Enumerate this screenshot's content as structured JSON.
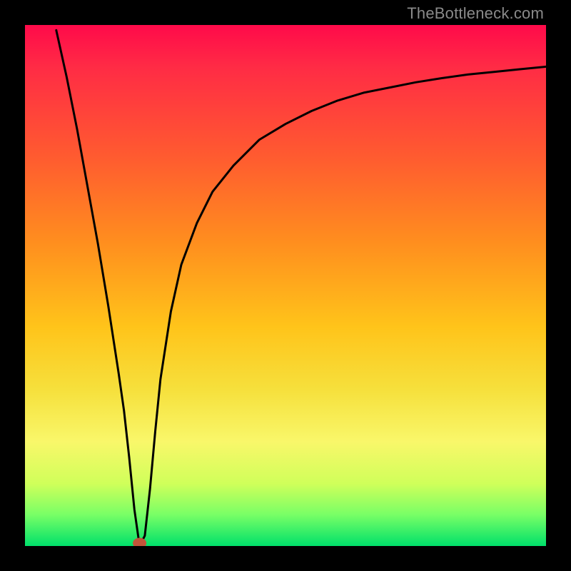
{
  "watermark": "TheBottleneck.com",
  "colors": {
    "frame": "#000000",
    "line": "#000000",
    "marker_fill": "#c2543a",
    "marker_stroke": "#c2543a"
  },
  "chart_data": {
    "type": "line",
    "title": "",
    "xlabel": "",
    "ylabel": "",
    "xlim": [
      0,
      100
    ],
    "ylim": [
      0,
      100
    ],
    "grid": false,
    "marker": {
      "x": 22,
      "y": 0,
      "shape": "ellipse"
    },
    "series": [
      {
        "name": "curve",
        "x": [
          6,
          8,
          10,
          12,
          14,
          16,
          18,
          19,
          20,
          21,
          22,
          23,
          24,
          25,
          26,
          28,
          30,
          33,
          36,
          40,
          45,
          50,
          55,
          60,
          65,
          70,
          75,
          80,
          85,
          90,
          95,
          100
        ],
        "y": [
          99,
          90,
          80,
          69,
          58,
          46,
          33,
          26,
          17,
          7,
          0,
          2,
          11,
          22,
          32,
          45,
          54,
          62,
          68,
          73,
          78,
          81,
          83.5,
          85.5,
          87,
          88,
          89,
          89.8,
          90.5,
          91,
          91.5,
          92
        ]
      }
    ]
  }
}
